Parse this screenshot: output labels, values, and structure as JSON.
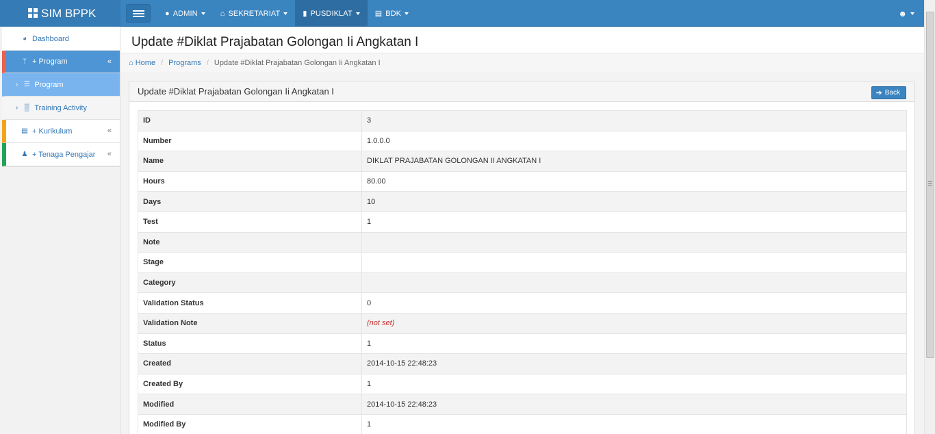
{
  "navbar": {
    "brand": "SIM BPPK",
    "menus": [
      {
        "label": "ADMIN",
        "icon": "android-icon"
      },
      {
        "label": "SEKRETARIAT",
        "icon": "home-icon"
      },
      {
        "label": "PUSDIKLAT",
        "icon": "book-icon"
      },
      {
        "label": "BDK",
        "icon": "bank-icon"
      }
    ]
  },
  "sidebar": {
    "items": [
      {
        "label": "Dashboard",
        "icon": "dashboard-icon"
      },
      {
        "label": "+ Program",
        "icon": "code-fork-icon"
      },
      {
        "label": "Program",
        "icon": "list-icon"
      },
      {
        "label": "Training Activity",
        "icon": "bar-chart-icon"
      },
      {
        "label": "+ Kurikulum",
        "icon": "bank-icon"
      },
      {
        "label": "+ Tenaga Pengajar",
        "icon": "users-icon"
      }
    ],
    "accent_colors": {
      "program": "#e8624f",
      "kurikulum": "#f4a41c",
      "tenaga": "#21a356"
    }
  },
  "page": {
    "title": "Update #Diklat Prajabatan Golongan Ii Angkatan I"
  },
  "breadcrumb": {
    "home": "Home",
    "programs": "Programs",
    "current": "Update #Diklat Prajabatan Golongan Ii Angkatan I"
  },
  "panel": {
    "heading": "Update #Diklat Prajabatan Golongan Ii Angkatan I",
    "back_label": "Back"
  },
  "details": [
    {
      "label": "ID",
      "value": "3"
    },
    {
      "label": "Number",
      "value": "1.0.0.0"
    },
    {
      "label": "Name",
      "value": "DIKLAT PRAJABATAN GOLONGAN II ANGKATAN I"
    },
    {
      "label": "Hours",
      "value": "80.00"
    },
    {
      "label": "Days",
      "value": "10"
    },
    {
      "label": "Test",
      "value": "1"
    },
    {
      "label": "Note",
      "value": ""
    },
    {
      "label": "Stage",
      "value": ""
    },
    {
      "label": "Category",
      "value": ""
    },
    {
      "label": "Validation Status",
      "value": "0"
    },
    {
      "label": "Validation Note",
      "value": "(not set)"
    },
    {
      "label": "Status",
      "value": "1"
    },
    {
      "label": "Created",
      "value": "2014-10-15 22:48:23"
    },
    {
      "label": "Created By",
      "value": "1"
    },
    {
      "label": "Modified",
      "value": "2014-10-15 22:48:23"
    },
    {
      "label": "Modified By",
      "value": "1"
    }
  ],
  "colors": {
    "primary": "#3a84c0",
    "link": "#3277b5",
    "not_set": "#c9302c"
  }
}
